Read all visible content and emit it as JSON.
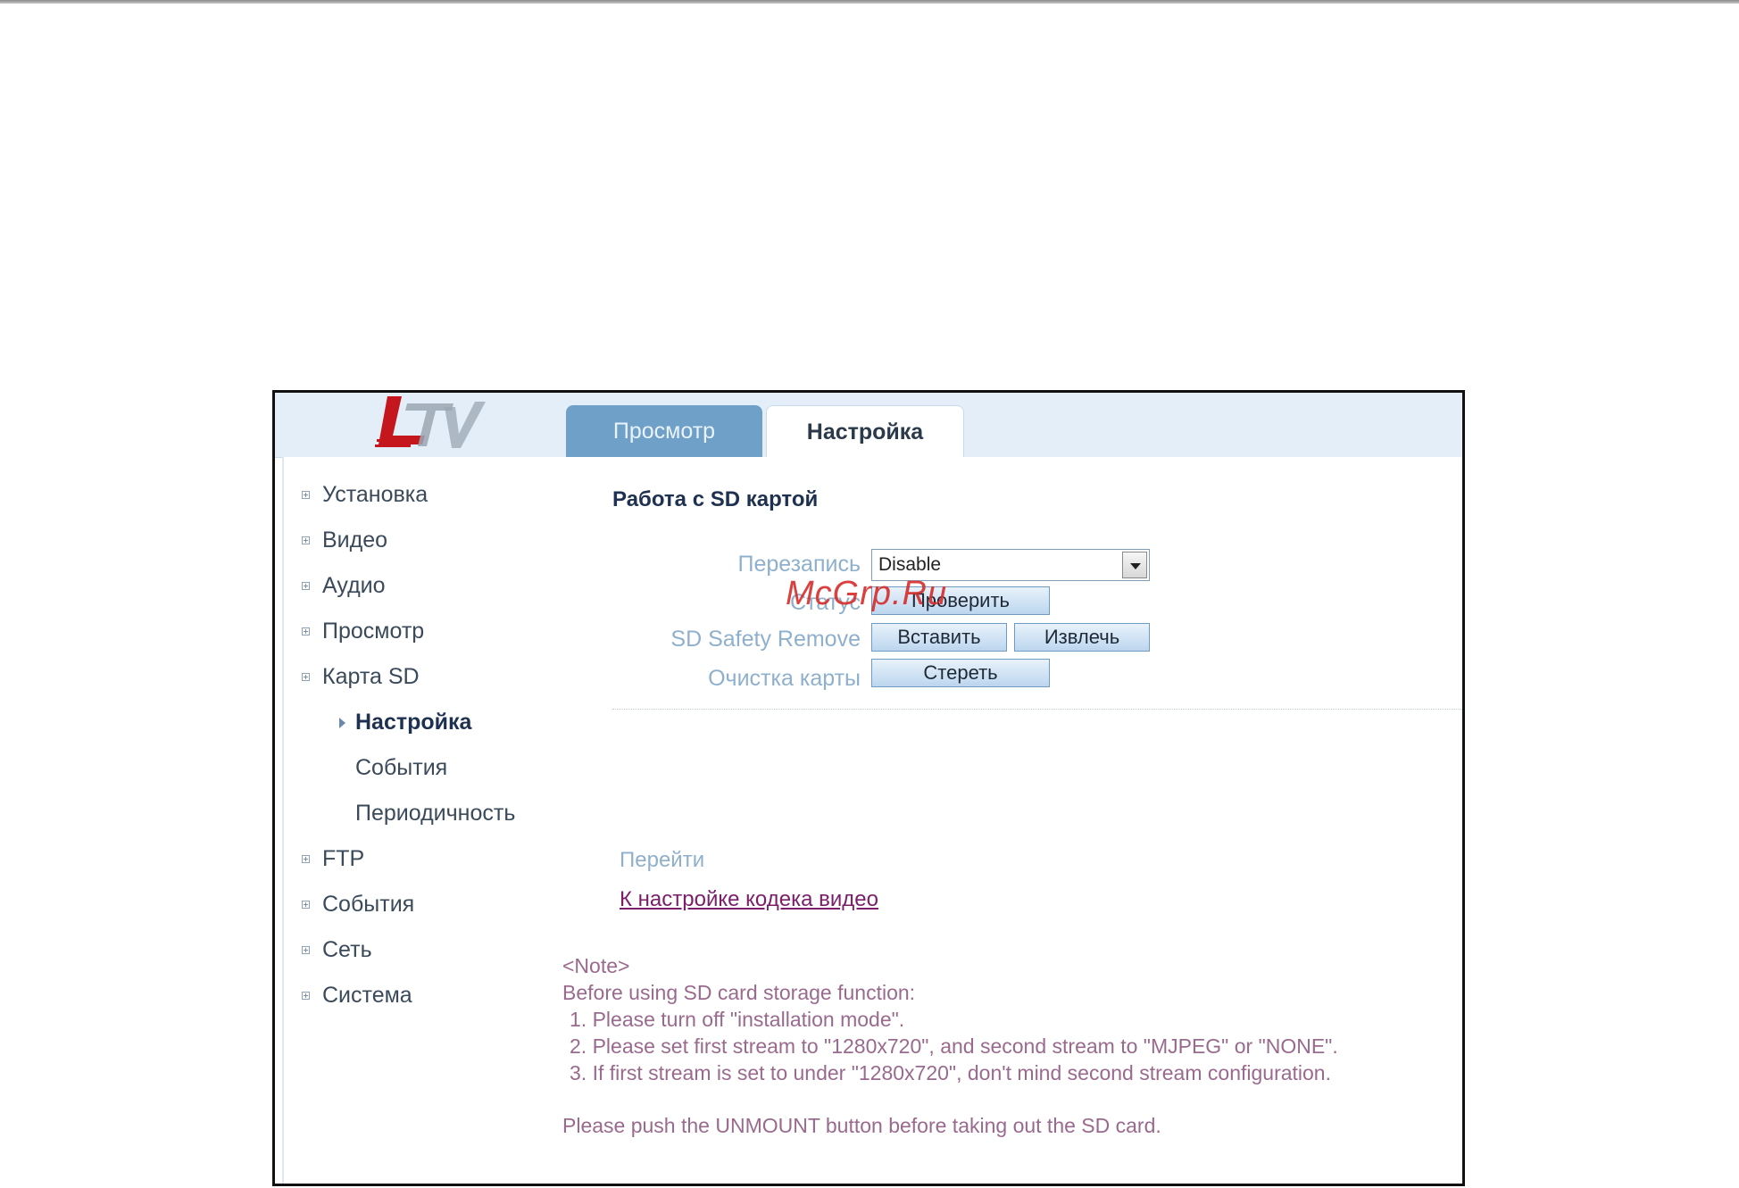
{
  "tabs": [
    {
      "label": "Просмотр",
      "active": false
    },
    {
      "label": "Настройка",
      "active": true
    }
  ],
  "sidebar": {
    "items": [
      {
        "label": "Установка"
      },
      {
        "label": "Видео"
      },
      {
        "label": "Аудио"
      },
      {
        "label": "Просмотр"
      },
      {
        "label": "Карта SD"
      }
    ],
    "sd_sub": [
      {
        "label": "Настройка",
        "active": true
      },
      {
        "label": "События"
      },
      {
        "label": "Периодичность"
      }
    ],
    "items_after": [
      {
        "label": "FTP"
      },
      {
        "label": "События"
      },
      {
        "label": "Сеть"
      },
      {
        "label": "Система"
      }
    ]
  },
  "main": {
    "title": "Работа с SD картой",
    "overwrite": {
      "label": "Перезапись",
      "value": "Disable"
    },
    "status": {
      "label": "Статус",
      "button": "Проверить"
    },
    "safety": {
      "label": "SD Safety Remove",
      "insert": "Вставить",
      "eject": "Извлечь"
    },
    "clear": {
      "label": "Очистка карты",
      "button": "Стереть"
    },
    "goto_label": "Перейти",
    "goto_link": "К настройке кодека видео",
    "note": {
      "heading": "<Note>",
      "intro": "Before using SD card storage function:",
      "items": [
        "1. Please turn off \"installation mode\".",
        "2. Please set first stream to \"1280x720\", and second stream to \"MJPEG\" or \"NONE\".",
        "3. If first stream is set to under \"1280x720\", don't mind second stream configuration."
      ],
      "footer": "Please push the UNMOUNT button before taking out the SD card."
    }
  },
  "watermark": "McGrp.Ru",
  "logo_text": "LTV",
  "colors": {
    "tab_active_text": "#2a3a4a",
    "tab_inactive_bg": "#6fa0c7",
    "label_blue": "#8fb0cc",
    "link_purple": "#7a1e6c",
    "note_text": "#9a6a8e",
    "watermark_red": "#d6302f"
  }
}
